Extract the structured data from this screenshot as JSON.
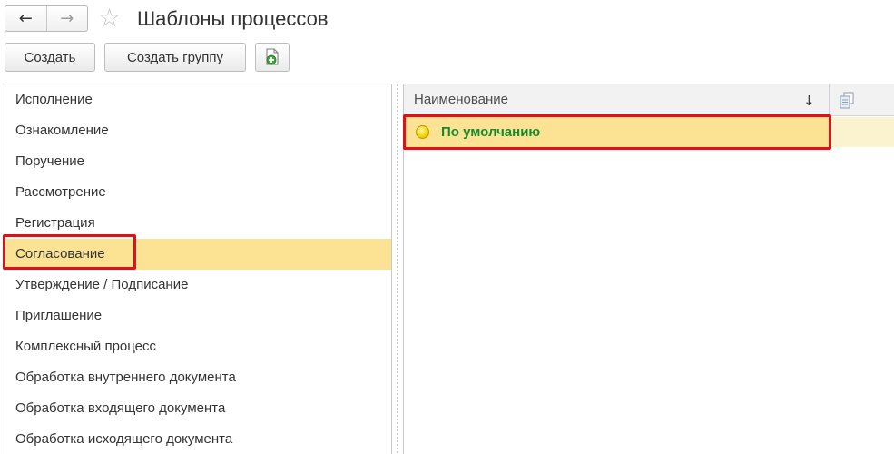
{
  "window": {
    "title": "Шаблоны процессов",
    "back_icon": "←",
    "forward_icon": "→",
    "favorite_icon": "☆"
  },
  "toolbar": {
    "create_label": "Создать",
    "create_group_label": "Создать группу",
    "add_icon": "add-document-icon"
  },
  "left_list": {
    "items": [
      "Исполнение",
      "Ознакомление",
      "Поручение",
      "Рассмотрение",
      "Регистрация",
      "Согласование",
      "Утверждение / Подписание",
      "Приглашение",
      "Комплексный процесс",
      "Обработка внутреннего документа",
      "Обработка входящего документа",
      "Обработка исходящего документа"
    ],
    "selected": "Согласование"
  },
  "table": {
    "columns": [
      "Наименование"
    ],
    "sort_icon": "↓",
    "copy_icon": "copy-icon",
    "rows": [
      {
        "name": "По умолчанию",
        "status_icon": "yellow-circle-icon"
      }
    ]
  },
  "colors": {
    "selection": "#fbe393",
    "highlight_border": "#e0101a",
    "row_text": "#17892e"
  }
}
